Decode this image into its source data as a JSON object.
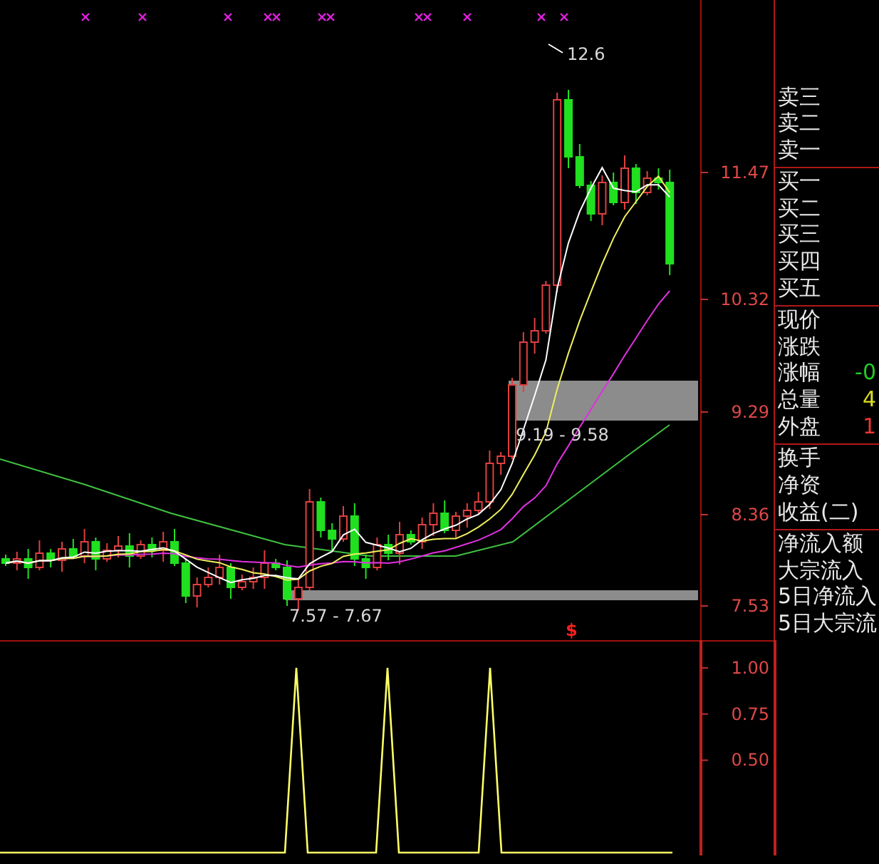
{
  "main_chart": {
    "price_ticks": [
      "11.47",
      "10.32",
      "9.29",
      "8.36",
      "7.53"
    ],
    "peak_label": "12.6",
    "zones": [
      {
        "label": "9.19 - 9.58"
      },
      {
        "label": "7.57 - 7.67"
      }
    ],
    "signal_mark": "$"
  },
  "quote_panel": {
    "sections": [
      {
        "rows": [
          {
            "label": "卖三"
          },
          {
            "label": "卖二"
          },
          {
            "label": "卖一"
          }
        ]
      },
      {
        "rows": [
          {
            "label": "买一"
          },
          {
            "label": "买二"
          },
          {
            "label": "买三"
          },
          {
            "label": "买四"
          },
          {
            "label": "买五"
          }
        ]
      },
      {
        "rows": [
          {
            "label": "现价"
          },
          {
            "label": "涨跌"
          },
          {
            "label": "涨幅",
            "value": "-0",
            "color": "#22cc22"
          },
          {
            "label": "总量",
            "value": "4",
            "color": "#dddd22"
          },
          {
            "label": "外盘",
            "value": "1",
            "color": "#ee3333"
          }
        ]
      },
      {
        "rows": [
          {
            "label": "换手"
          },
          {
            "label": "净资"
          },
          {
            "label": "收益(二)"
          }
        ]
      },
      {
        "rows": [
          {
            "label": "净流入额"
          },
          {
            "label": "大宗流入"
          },
          {
            "label": "5日净流入"
          },
          {
            "label": "5日大宗流"
          }
        ]
      }
    ]
  },
  "indicator_chart": {
    "chart_data": {
      "type": "line",
      "ylim": [
        0,
        1.15
      ],
      "yticks": [
        {
          "value": 1,
          "label": "1.00"
        },
        {
          "value": 0.75,
          "label": "0.75"
        },
        {
          "value": 0.5,
          "label": "0.50"
        }
      ],
      "series": [
        {
          "color": "#ffff66",
          "values": [
            0,
            0,
            0,
            0,
            0,
            0,
            0,
            0,
            0,
            0,
            0,
            0,
            0,
            0,
            0,
            0,
            0,
            0,
            0,
            0,
            0,
            0,
            0,
            0,
            0,
            0,
            1,
            0,
            0,
            0,
            0,
            0,
            0,
            0,
            1,
            0,
            0,
            0,
            0,
            0,
            0,
            0,
            0,
            1,
            0,
            0,
            0,
            0,
            0,
            0,
            0,
            0,
            0,
            0,
            0,
            0,
            0,
            0,
            0,
            0
          ]
        }
      ]
    }
  }
}
